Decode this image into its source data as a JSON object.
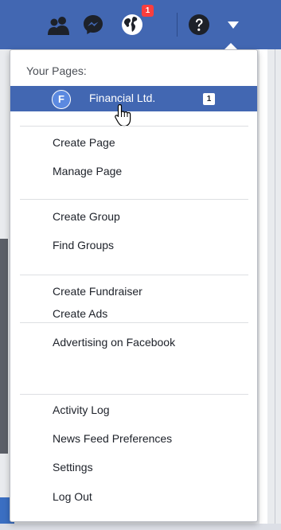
{
  "topbar": {
    "color": "#4267b2",
    "icons": [
      "friends-icon",
      "messenger-icon",
      "globe-icon",
      "help-icon",
      "caret-down-icon"
    ],
    "notification_count": "1"
  },
  "menu": {
    "header": "Your Pages:",
    "pages": [
      {
        "initial": "F",
        "name": "Financial Ltd.",
        "count": "1"
      }
    ],
    "groups": [
      [
        "Create Page",
        "Manage Page"
      ],
      [
        "Create Group",
        "Find Groups"
      ],
      [
        "Create Fundraiser"
      ],
      [
        "Create Ads",
        "Advertising on Facebook"
      ],
      [
        "Activity Log",
        "News Feed Preferences",
        "Settings",
        "Log Out"
      ]
    ]
  }
}
